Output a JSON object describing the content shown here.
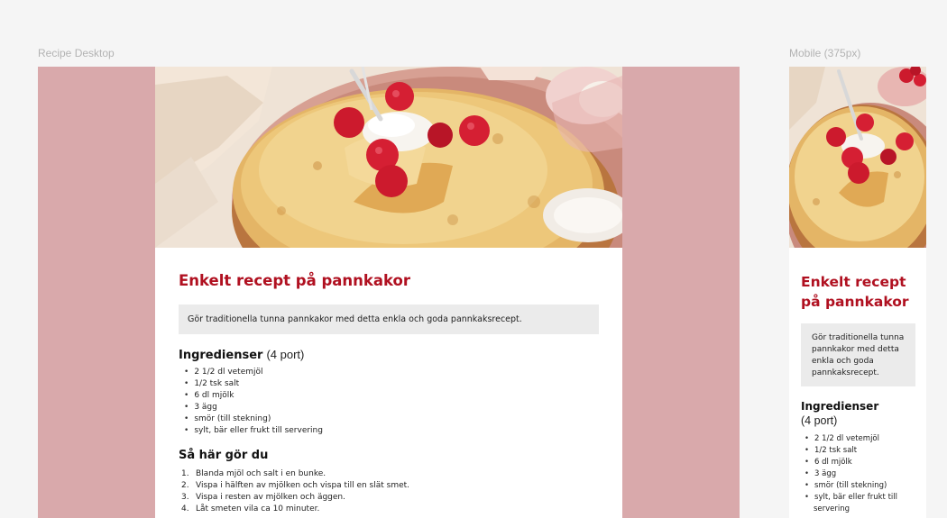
{
  "frames": {
    "desktop_label": "Recipe Desktop",
    "mobile_label": "Mobile (375px)"
  },
  "colors": {
    "background": "#f5f5f5",
    "side_band": "#d9a9ab",
    "title": "#b01020",
    "intro_box": "#ebebeb"
  },
  "hero_image": {
    "icon": "pancake-photo"
  },
  "recipe": {
    "title": "Enkelt recept på pannkakor",
    "intro": "Gör traditionella tunna pannkakor med detta enkla och goda pannkaksrecept.",
    "ingredients_heading": "Ingredienser",
    "portions": "(4 port)",
    "ingredients": [
      "2 1/2 dl vetemjöl",
      "1/2 tsk salt",
      "6 dl mjölk",
      "3 ägg",
      "smör (till stekning)",
      "sylt, bär eller frukt till servering"
    ],
    "steps_heading": "Så här gör du",
    "steps": [
      {
        "num": "1.",
        "text": "Blanda mjöl och salt i en bunke."
      },
      {
        "num": "2.",
        "text": "Vispa i hälften av mjölken och vispa till en slät smet."
      },
      {
        "num": "3.",
        "text": "Vispa i resten av mjölken och äggen."
      },
      {
        "num": "4.",
        "text": "Låt smeten vila ca 10 minuter."
      }
    ]
  }
}
